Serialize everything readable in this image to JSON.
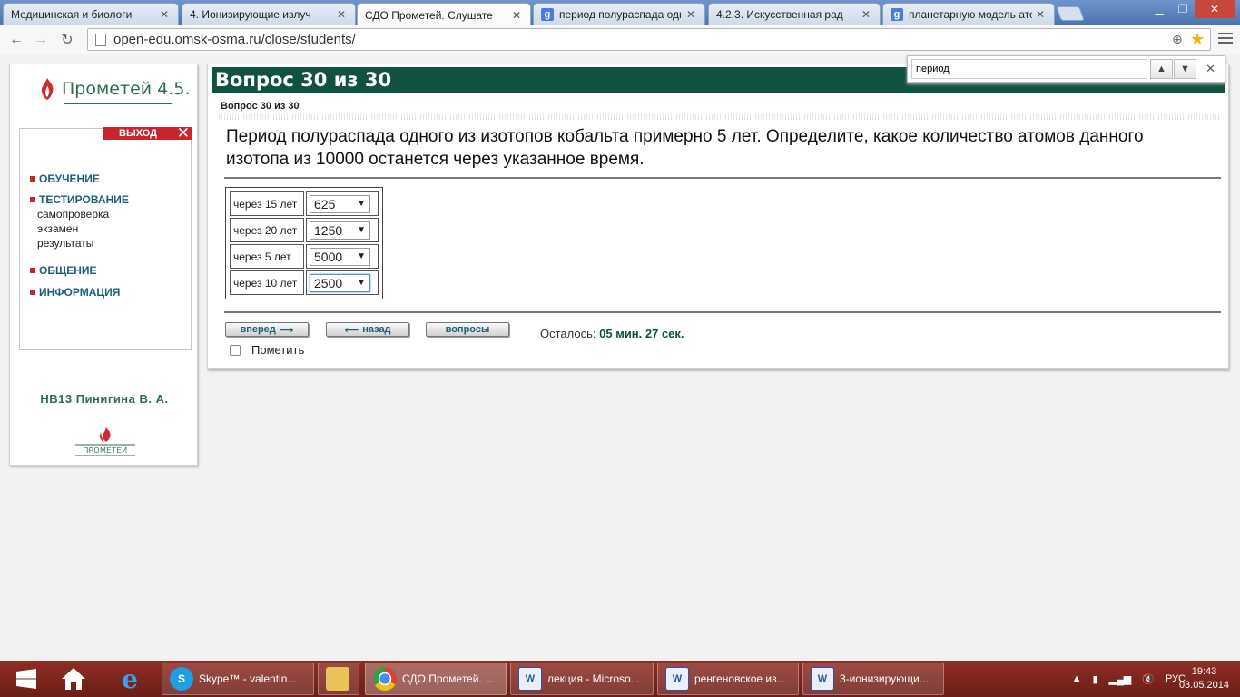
{
  "browser": {
    "tabs": [
      {
        "title": "Медицинская и биологи",
        "icon": "page-icon"
      },
      {
        "title": "4. Ионизирующие излуч",
        "icon": "page-icon"
      },
      {
        "title": "СДО Прометей. Слушате",
        "icon": "page-icon",
        "active": true
      },
      {
        "title": "период полураспада одн",
        "icon": "google-icon"
      },
      {
        "title": "4.2.3. Искусственная рад",
        "icon": "page-icon"
      },
      {
        "title": "планетарную модель ато",
        "icon": "google-icon"
      }
    ],
    "url": "open-edu.omsk-osma.ru/close/students/"
  },
  "find": {
    "query": "период"
  },
  "sidebar": {
    "logo_text": "Прометей 4.5.",
    "exit_label": "ВЫХОД",
    "menu": [
      {
        "label": "ОБУЧЕНИЕ"
      },
      {
        "label": "ТЕСТИРОВАНИЕ",
        "subitems": [
          "самопроверка",
          "экзамен",
          "результаты"
        ]
      },
      {
        "label": "ОБЩЕНИЕ"
      },
      {
        "label": "ИНФОРМАЦИЯ"
      }
    ],
    "user": "НВ13 Пинигина В. А.",
    "bottom_logo_text": "ПРОМЕТЕЙ"
  },
  "question": {
    "header": "Вопрос 30 из 30",
    "subheader": "Вопрос 30 из 30",
    "text": "Период полураспада одного из изотопов кобальта примерно 5 лет. Определите, какое количество атомов данного изотопа из 10000 останется через указанное время.",
    "rows": [
      {
        "label": "через 15 лет",
        "value": "625"
      },
      {
        "label": "через 20 лет",
        "value": "1250"
      },
      {
        "label": "через 5 лет",
        "value": "5000"
      },
      {
        "label": "через 10 лет",
        "value": "2500"
      }
    ],
    "buttons": {
      "forward": "вперед",
      "back": "назад",
      "questions": "вопросы"
    },
    "remaining_label": "Осталось:",
    "remaining_value": "05 мин. 27 сек.",
    "mark_label": "Пометить"
  },
  "taskbar": {
    "items": [
      {
        "label": "Skype™ - valentin...",
        "icon": "skype-icon"
      },
      {
        "label": "",
        "icon": "folder-icon"
      },
      {
        "label": "СДО Прометей. ...",
        "icon": "chrome-icon",
        "active": true
      },
      {
        "label": "лекция - Microso...",
        "icon": "word-icon"
      },
      {
        "label": "ренгеновское из...",
        "icon": "word-icon"
      },
      {
        "label": "3-ионизирующи...",
        "icon": "word-icon"
      }
    ],
    "lang": "РУС",
    "time": "19:43",
    "date": "03.05.2014"
  },
  "colors": {
    "accent": "#0f5240",
    "exit": "#c8252f",
    "menu_text": "#1f5e78",
    "taskbar": "#7d241c"
  }
}
